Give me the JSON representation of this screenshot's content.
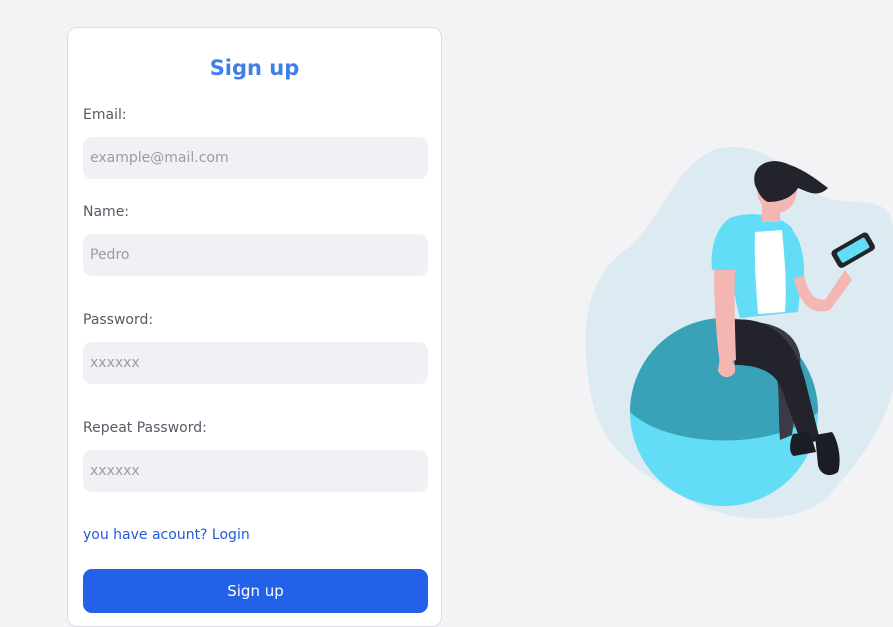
{
  "form": {
    "title": "Sign up",
    "email_label": "Email:",
    "email_placeholder": "example@mail.com",
    "name_label": "Name:",
    "name_placeholder": "Pedro",
    "password_label": "Password:",
    "password_placeholder": "xxxxxx",
    "repeat_password_label": "Repeat Password:",
    "repeat_password_placeholder": "xxxxxx",
    "login_link": "you have acount? Login",
    "submit_label": "Sign up"
  },
  "colors": {
    "background": "#f3f2f5",
    "accent": "#3f7fe6",
    "button": "#2361e8",
    "link": "#2258d8"
  }
}
